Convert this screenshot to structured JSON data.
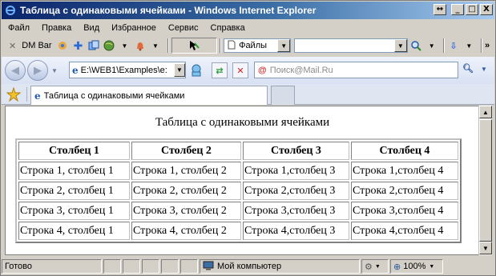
{
  "window": {
    "title": "Таблица с одинаковыми ячейками - Windows Internet Explorer",
    "buttons": {
      "restore": "↔",
      "minimize": "_",
      "maximize": "□",
      "close": "X"
    }
  },
  "menu": [
    "Файл",
    "Правка",
    "Вид",
    "Избранное",
    "Сервис",
    "Справка"
  ],
  "toolbar": {
    "dm_bar_label": "DM Bar",
    "files_label": "Файлы",
    "more": "»"
  },
  "address": {
    "url": "E:\\WEB1\\Examples\\e:",
    "search_placeholder": "Поиск@Mail.Ru"
  },
  "tabs": {
    "active_label": "Таблица с одинаковыми ячейками"
  },
  "page": {
    "caption": "Таблица с одинаковыми ячейками",
    "headers": [
      "Столбец 1",
      "Столбец 2",
      "Столбец 3",
      "Столбец 4"
    ],
    "rows": [
      [
        "Строка 1, столбец 1",
        "Строка 1, столбец 2",
        "Строка 1,столбец 3",
        "Строка 1,столбец 4"
      ],
      [
        "Строка 2, столбец 1",
        "Строка 2, столбец 2",
        "Строка 2,столбец 3",
        "Строка 2,столбец 4"
      ],
      [
        "Строка 3, столбец 1",
        "Строка 3, столбец 2",
        "Строка 3,столбец 3",
        "Строка 3,столбец 4"
      ],
      [
        "Строка 4, столбец 1",
        "Строка 4, столбец 2",
        "Строка 4,столбец 3",
        "Строка 4,столбец 4"
      ]
    ]
  },
  "status": {
    "text": "Готово",
    "zone": "Мой компьютер",
    "zoom": "100%"
  }
}
